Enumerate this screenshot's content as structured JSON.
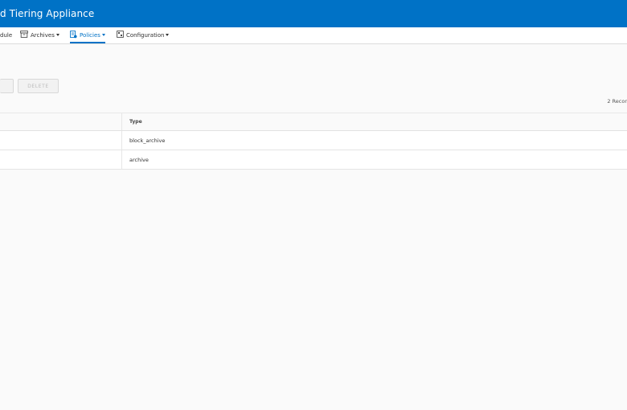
{
  "app": {
    "title": "d Tiering Appliance"
  },
  "nav": {
    "items": [
      {
        "label": "dule",
        "icon": "",
        "caret": false
      },
      {
        "label": "Archives",
        "icon": "archive-icon",
        "caret": true
      },
      {
        "label": "Policies",
        "icon": "policy-icon",
        "caret": true,
        "active": true
      },
      {
        "label": "Configuration",
        "icon": "configuration-icon",
        "caret": true
      }
    ]
  },
  "toolbar": {
    "delete_label": "DELETE"
  },
  "grid": {
    "record_count": "2 Recor",
    "columns": [
      "",
      "Type"
    ],
    "rows": [
      {
        "type": "block_archive"
      },
      {
        "type": "archive"
      }
    ]
  },
  "colors": {
    "accent": "#0072c6"
  }
}
